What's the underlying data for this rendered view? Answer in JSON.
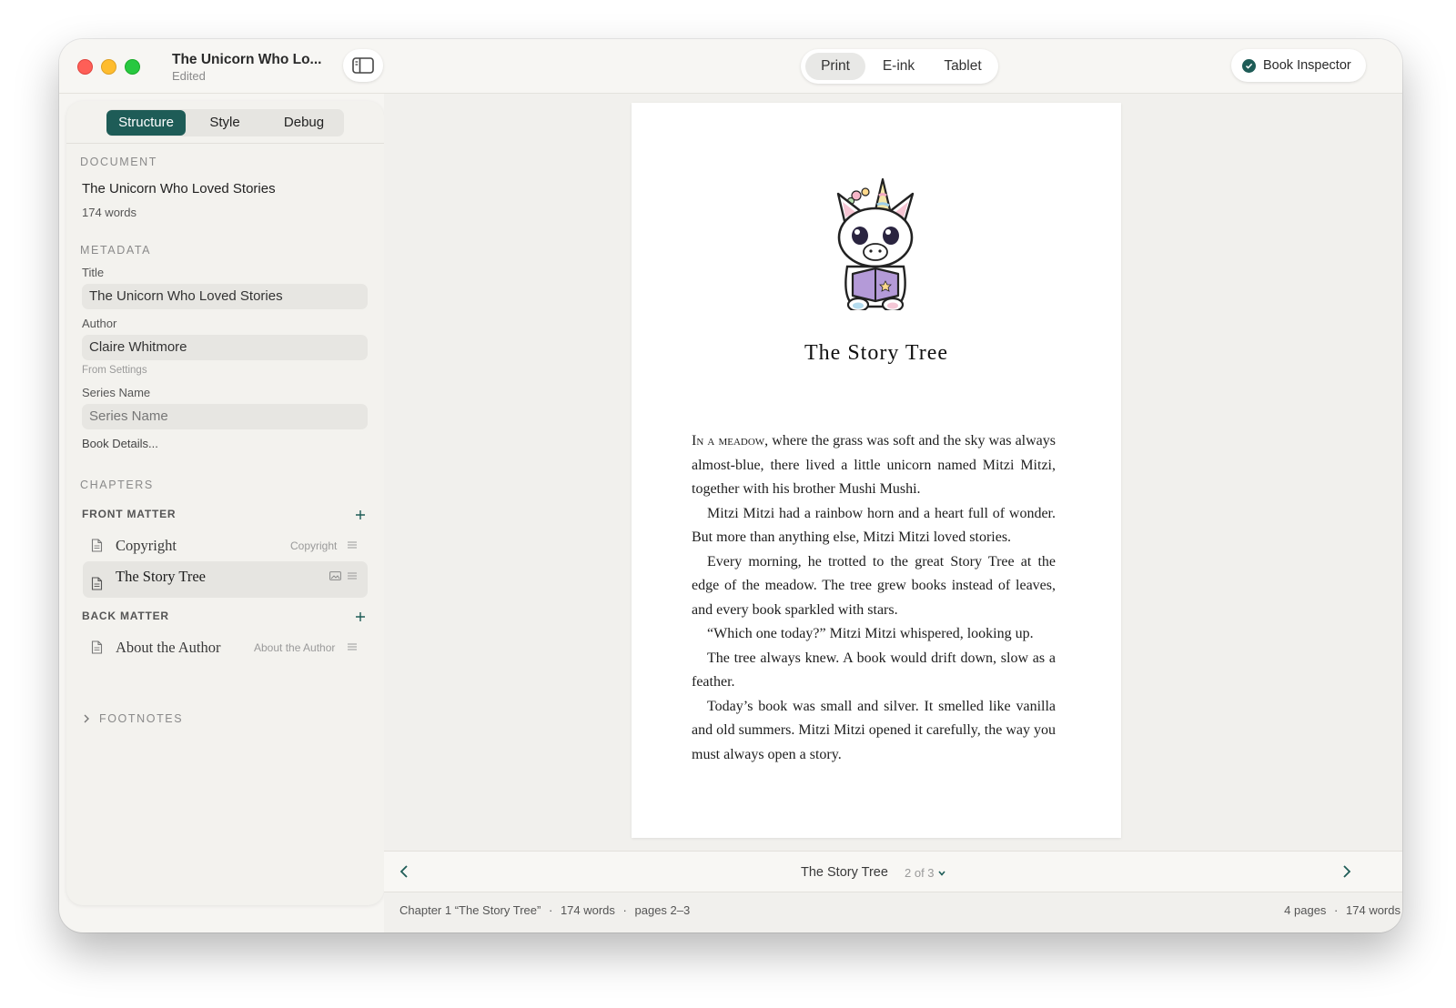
{
  "window": {
    "title": "The Unicorn Who Lo...",
    "subtitle": "Edited"
  },
  "toolbar": {
    "devices": [
      "Print",
      "E-ink",
      "Tablet"
    ],
    "active_device": "Print",
    "inspector_label": "Book Inspector"
  },
  "sidebar": {
    "tabs": [
      "Structure",
      "Style",
      "Debug"
    ],
    "active_tab": "Structure",
    "document": {
      "section_label": "DOCUMENT",
      "title": "The Unicorn Who Loved Stories",
      "words": "174 words"
    },
    "metadata": {
      "section_label": "METADATA",
      "title_label": "Title",
      "title_value": "The Unicorn Who Loved Stories",
      "author_label": "Author",
      "author_value": "Claire Whitmore",
      "author_hint": "From Settings",
      "series_label": "Series Name",
      "series_placeholder": "Series Name",
      "details_link": "Book Details..."
    },
    "chapters": {
      "section_label": "CHAPTERS",
      "front_matter_label": "FRONT MATTER",
      "front_matter": [
        {
          "name": "Copyright",
          "type": "Copyright"
        },
        {
          "name": "The Story Tree",
          "type": ""
        }
      ],
      "back_matter_label": "BACK MATTER",
      "back_matter": [
        {
          "name": "About the Author",
          "type": "About the Author"
        }
      ]
    },
    "footnotes_label": "FOOTNOTES"
  },
  "page": {
    "chapter_title": "The Story Tree",
    "lead_in": "In a meadow,",
    "paragraphs": [
      " where the grass was soft and the sky was always almost-blue, there lived a little unicorn named Mitzi Mitzi, together with his brother Mushi Mushi.",
      "Mitzi Mitzi had a rainbow horn and a heart full of wonder. But more than anything else, Mitzi Mitzi loved stories.",
      "Every morning, he trotted to the great Story Tree at the edge of the meadow. The tree grew books instead of leaves, and every book sparkled with stars.",
      "“Which one today?” Mitzi Mitzi whispered, looking up.",
      "The tree always knew. A book would drift down, slow as a feather.",
      "Today’s book was small and silver. It smelled like vanilla and old summers. Mitzi Mitzi opened it carefully, the way you must always open a story."
    ]
  },
  "page_nav": {
    "chapter_name": "The Story Tree",
    "page_count": "2 of 3"
  },
  "status": {
    "chapter": "Chapter 1 “The Story Tree”",
    "chapter_words": "174 words",
    "chapter_pages": "pages 2–3",
    "total_pages": "4 pages",
    "total_words": "174 words",
    "separator": "·"
  },
  "colors": {
    "accent": "#1e5c57",
    "window_bg": "#f6f5f2",
    "close": "#fe5f57",
    "minimize": "#febc2e",
    "zoom": "#28c840"
  }
}
